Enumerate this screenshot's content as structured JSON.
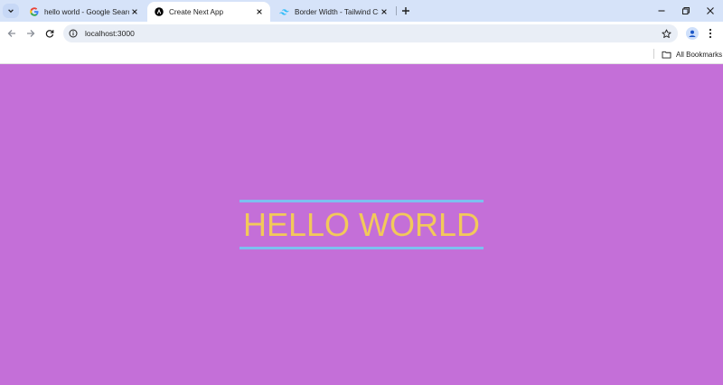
{
  "browser": {
    "tabs": [
      {
        "title": "hello world - Google Search",
        "icon": "google-icon"
      },
      {
        "title": "Create Next App",
        "icon": "nextjs-icon",
        "active": true
      },
      {
        "title": "Border Width - Tailwind CSS",
        "icon": "tailwind-icon"
      }
    ],
    "address": "localhost:3000",
    "bookmarks_label": "All Bookmarks"
  },
  "page": {
    "heading": "HELLO WORLD",
    "background_color": "#c46fd8",
    "text_color": "#f2c95a",
    "border_color": "#7cc0f0"
  }
}
